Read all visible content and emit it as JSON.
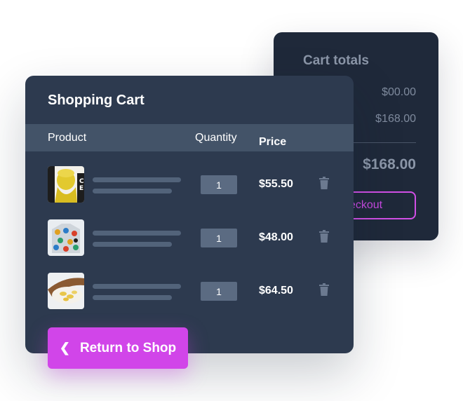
{
  "totals": {
    "title": "Cart totals",
    "subtotal": "$00.00",
    "shipping": "$168.00",
    "total": "$168.00",
    "checkout_label": "eckout"
  },
  "cart": {
    "title": "Shopping Cart",
    "columns": {
      "product": "Product",
      "quantity": "Quantity",
      "price": "Price"
    },
    "items": [
      {
        "quantity": "1",
        "price": "$55.50"
      },
      {
        "quantity": "1",
        "price": "$48.00"
      },
      {
        "quantity": "1",
        "price": "$64.50"
      }
    ]
  },
  "return_button": {
    "label": "Return to Shop",
    "icon": "chevron-left-icon"
  },
  "colors": {
    "accent": "#d145e9",
    "card_front": "#2d3a4f",
    "card_back": "#1f293a",
    "header_row": "#435368"
  }
}
